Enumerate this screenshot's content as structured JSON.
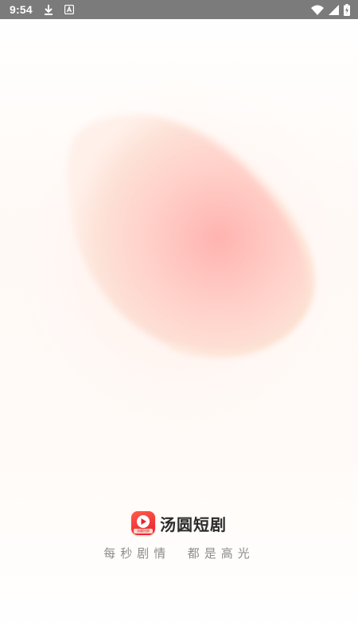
{
  "status_bar": {
    "time": "9:54",
    "left_icons": [
      "download-icon",
      "font-a-icon"
    ],
    "right_icons": [
      "wifi-icon",
      "cell-signal-icon",
      "battery-charging-icon"
    ]
  },
  "brand": {
    "app_name": "汤圆短剧",
    "logo_tag": "汤圆短剧",
    "slogan": "每秒剧情  都是高光"
  },
  "colors": {
    "status_bar_bg": "#7b7b7b",
    "blob_pink": "#ffb3b0",
    "blob_peach": "#fdd3c4",
    "logo_red": "#e8222e"
  }
}
